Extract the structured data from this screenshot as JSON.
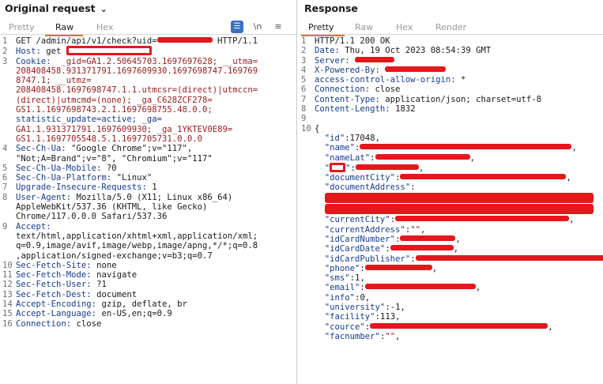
{
  "request": {
    "title": "Original request",
    "tabs": [
      "Pretty",
      "Raw",
      "Hex"
    ],
    "active_tab": "Raw",
    "tools": {
      "newline_toggle": "\\n",
      "menu": "≡"
    },
    "lines": [
      {
        "n": "1",
        "parts": [
          [
            "k",
            "GET /admin/api/v1/check?uid="
          ],
          [
            "redact",
            "70"
          ],
          [
            "k",
            " HTTP/1.1"
          ]
        ]
      },
      {
        "n": "2",
        "parts": [
          [
            "hdr",
            "Host: "
          ],
          [
            "hv",
            "get "
          ],
          [
            "redactbox",
            "108"
          ]
        ]
      },
      {
        "n": "3",
        "parts": [
          [
            "hdr",
            "Cookie: "
          ],
          [
            "ck",
            " _gid=GA1.2.50645703.1697697628; __utma="
          ]
        ]
      },
      {
        "n": "",
        "parts": [
          [
            "ck",
            "208408458.931371791.1697609930.1697698747.169769"
          ]
        ]
      },
      {
        "n": "",
        "parts": [
          [
            "ck",
            "8747.1; __utmz="
          ]
        ]
      },
      {
        "n": "",
        "parts": [
          [
            "ck",
            "208408458.1697698747.1.1.utmcsr=(direct)|utmccn="
          ]
        ]
      },
      {
        "n": "",
        "parts": [
          [
            "ck",
            "(direct)|utmcmd=(none); _ga_C628ZCF278="
          ]
        ]
      },
      {
        "n": "",
        "parts": [
          [
            "ck",
            "GS1.1.1697698743.2.1.1697698755.48.0.0;"
          ]
        ]
      },
      {
        "n": "",
        "parts": [
          [
            "hdr",
            "statistic_update=active; _ga="
          ]
        ]
      },
      {
        "n": "",
        "parts": [
          [
            "ck",
            "GA1.1.931371791.1697609930; _ga_1YKTEV0E89="
          ]
        ]
      },
      {
        "n": "",
        "parts": [
          [
            "ck",
            "GS1.1.1697705548.5.1.1697705731.0.0.0"
          ]
        ]
      },
      {
        "n": "4",
        "parts": [
          [
            "hdr",
            "Sec-Ch-Ua: "
          ],
          [
            "hv",
            "\"Google Chrome\";v=\"117\","
          ]
        ]
      },
      {
        "n": "",
        "parts": [
          [
            "hv",
            "\"Not;A=Brand\";v=\"8\", \"Chromium\";v=\"117\""
          ]
        ]
      },
      {
        "n": "5",
        "parts": [
          [
            "hdr",
            "Sec-Ch-Ua-Mobile: "
          ],
          [
            "hv",
            "?0"
          ]
        ]
      },
      {
        "n": "6",
        "parts": [
          [
            "hdr",
            "Sec-Ch-Ua-Platform: "
          ],
          [
            "hv",
            "\"Linux\""
          ]
        ]
      },
      {
        "n": "7",
        "parts": [
          [
            "hdr",
            "Upgrade-Insecure-Requests: "
          ],
          [
            "hv",
            "1"
          ]
        ]
      },
      {
        "n": "8",
        "parts": [
          [
            "hdr",
            "User-Agent: "
          ],
          [
            "hv",
            "Mozilla/5.0 (X11; Linux x86_64)"
          ]
        ]
      },
      {
        "n": "",
        "parts": [
          [
            "hv",
            "AppleWebKit/537.36 (KHTML, like Gecko)"
          ]
        ]
      },
      {
        "n": "",
        "parts": [
          [
            "hv",
            "Chrome/117.0.0.0 Safari/537.36"
          ]
        ]
      },
      {
        "n": "9",
        "parts": [
          [
            "hdr",
            "Accept: "
          ]
        ]
      },
      {
        "n": "",
        "parts": [
          [
            "hv",
            "text/html,application/xhtml+xml,application/xml;"
          ]
        ]
      },
      {
        "n": "",
        "parts": [
          [
            "hv",
            "q=0.9,image/avif,image/webp,image/apng,*/*;q=0.8"
          ]
        ]
      },
      {
        "n": "",
        "parts": [
          [
            "hv",
            ",application/signed-exchange;v=b3;q=0.7"
          ]
        ]
      },
      {
        "n": "10",
        "parts": [
          [
            "hdr",
            "Sec-Fetch-Site: "
          ],
          [
            "hv",
            "none"
          ]
        ]
      },
      {
        "n": "11",
        "parts": [
          [
            "hdr",
            "Sec-Fetch-Mode: "
          ],
          [
            "hv",
            "navigate"
          ]
        ]
      },
      {
        "n": "12",
        "parts": [
          [
            "hdr",
            "Sec-Fetch-User: "
          ],
          [
            "hv",
            "?1"
          ]
        ]
      },
      {
        "n": "13",
        "parts": [
          [
            "hdr",
            "Sec-Fetch-Dest: "
          ],
          [
            "hv",
            "document"
          ]
        ]
      },
      {
        "n": "14",
        "parts": [
          [
            "hdr",
            "Accept-Encoding: "
          ],
          [
            "hv",
            "gzip, deflate, br"
          ]
        ]
      },
      {
        "n": "15",
        "parts": [
          [
            "hdr",
            "Accept-Language: "
          ],
          [
            "hv",
            "en-US,en;q=0.9"
          ]
        ]
      },
      {
        "n": "16",
        "parts": [
          [
            "hdr",
            "Connection: "
          ],
          [
            "hv",
            "close"
          ]
        ]
      }
    ]
  },
  "response": {
    "title": "Response",
    "tabs": [
      "Pretty",
      "Raw",
      "Hex",
      "Render"
    ],
    "active_tab": "Pretty",
    "lines": [
      {
        "n": "1",
        "parts": [
          [
            "k",
            "HTTP/1.1 200 OK"
          ]
        ]
      },
      {
        "n": "2",
        "parts": [
          [
            "hdr",
            "Date: "
          ],
          [
            "hv",
            "Thu, 19 Oct 2023 08:54:39 GMT"
          ]
        ]
      },
      {
        "n": "3",
        "parts": [
          [
            "hdr",
            "Server: "
          ],
          [
            "redact",
            "50"
          ]
        ]
      },
      {
        "n": "4",
        "parts": [
          [
            "hdr",
            "X-Powered-By: "
          ],
          [
            "redact",
            "77"
          ]
        ]
      },
      {
        "n": "5",
        "parts": [
          [
            "hdr",
            "access-control-allow-origin: "
          ],
          [
            "hv",
            "*"
          ]
        ]
      },
      {
        "n": "6",
        "parts": [
          [
            "hdr",
            "Connection: "
          ],
          [
            "hv",
            "close"
          ]
        ]
      },
      {
        "n": "7",
        "parts": [
          [
            "hdr",
            "Content-Type: "
          ],
          [
            "hv",
            "application/json; charset=utf-8"
          ]
        ]
      },
      {
        "n": "8",
        "parts": [
          [
            "hdr",
            "Content-Length: "
          ],
          [
            "hv",
            "1832"
          ]
        ]
      },
      {
        "n": "9",
        "parts": []
      },
      {
        "n": "10",
        "parts": [
          [
            "pun",
            "{"
          ]
        ]
      },
      {
        "n": "",
        "parts": [
          [
            "pun",
            "  "
          ],
          [
            "jk",
            "\"id\""
          ],
          [
            "pun",
            ":"
          ],
          [
            "jn",
            "17048"
          ],
          [
            "pun",
            ","
          ]
        ]
      },
      {
        "n": "",
        "parts": [
          [
            "pun",
            "  "
          ],
          [
            "jk",
            "\"name\""
          ],
          [
            "pun",
            ":"
          ],
          [
            "redact",
            "268"
          ],
          [
            "pun",
            ","
          ]
        ]
      },
      {
        "n": "",
        "parts": [
          [
            "pun",
            "  "
          ],
          [
            "jk",
            "\"nameLat\""
          ],
          [
            "pun",
            ":"
          ],
          [
            "redact",
            "120"
          ],
          [
            "pun",
            ","
          ]
        ]
      },
      {
        "n": "",
        "parts": [
          [
            "pun",
            "  "
          ],
          [
            "jk",
            "\""
          ],
          [
            "redactbox",
            "20"
          ],
          [
            "jk",
            "\""
          ],
          [
            "pun",
            ":"
          ],
          [
            "redact",
            "80"
          ],
          [
            "pun",
            ","
          ]
        ]
      },
      {
        "n": "",
        "parts": [
          [
            "pun",
            "  "
          ],
          [
            "jk",
            "\"documentCity\""
          ],
          [
            "pun",
            ":"
          ],
          [
            "redact",
            "210"
          ],
          [
            "pun",
            ","
          ]
        ]
      },
      {
        "n": "",
        "parts": [
          [
            "pun",
            "  "
          ],
          [
            "jk",
            "\"documentAddress\""
          ],
          [
            "pun",
            ":"
          ]
        ]
      },
      {
        "n": "",
        "parts": [
          [
            "pun",
            "  "
          ],
          [
            "redactbig",
            "340"
          ]
        ]
      },
      {
        "n": "",
        "parts": [
          [
            "pun",
            "  "
          ],
          [
            "redactbig",
            "340"
          ]
        ]
      },
      {
        "n": "",
        "parts": [
          [
            "pun",
            "  "
          ],
          [
            "jk",
            "\"currentCity\""
          ],
          [
            "pun",
            ":"
          ],
          [
            "redact",
            "220"
          ],
          [
            "pun",
            ","
          ]
        ]
      },
      {
        "n": "",
        "parts": [
          [
            "pun",
            "  "
          ],
          [
            "jk",
            "\"currentAddress\""
          ],
          [
            "pun",
            ":"
          ],
          [
            "js",
            "\"\""
          ],
          [
            "pun",
            ","
          ]
        ]
      },
      {
        "n": "",
        "parts": [
          [
            "pun",
            "  "
          ],
          [
            "jk",
            "\"idCardNumber\""
          ],
          [
            "pun",
            ":"
          ],
          [
            "redact",
            "70"
          ],
          [
            "pun",
            ","
          ]
        ]
      },
      {
        "n": "",
        "parts": [
          [
            "pun",
            "  "
          ],
          [
            "jk",
            "\"idCardDate\""
          ],
          [
            "pun",
            ":"
          ],
          [
            "redact",
            "80"
          ],
          [
            "pun",
            ","
          ]
        ]
      },
      {
        "n": "",
        "parts": [
          [
            "pun",
            "  "
          ],
          [
            "jk",
            "\"idCardPublisher\""
          ],
          [
            "pun",
            ":"
          ],
          [
            "redact",
            "245"
          ],
          [
            "pun",
            ","
          ]
        ]
      },
      {
        "n": "",
        "parts": [
          [
            "pun",
            "  "
          ],
          [
            "jk",
            "\"phone\""
          ],
          [
            "pun",
            ":"
          ],
          [
            "redact",
            "85"
          ],
          [
            "pun",
            ","
          ]
        ]
      },
      {
        "n": "",
        "parts": [
          [
            "pun",
            "  "
          ],
          [
            "jk",
            "\"sms\""
          ],
          [
            "pun",
            ":"
          ],
          [
            "jn",
            "1"
          ],
          [
            "pun",
            ","
          ]
        ]
      },
      {
        "n": "",
        "parts": [
          [
            "pun",
            "  "
          ],
          [
            "jk",
            "\"email\""
          ],
          [
            "pun",
            ":"
          ],
          [
            "redact",
            "140"
          ],
          [
            "pun",
            ","
          ]
        ]
      },
      {
        "n": "",
        "parts": [
          [
            "pun",
            "  "
          ],
          [
            "jk",
            "\"info\""
          ],
          [
            "pun",
            ":"
          ],
          [
            "jn",
            "0"
          ],
          [
            "pun",
            ","
          ]
        ]
      },
      {
        "n": "",
        "parts": [
          [
            "pun",
            "  "
          ],
          [
            "jk",
            "\"university\""
          ],
          [
            "pun",
            ":"
          ],
          [
            "jn",
            "-1"
          ],
          [
            "pun",
            ","
          ]
        ]
      },
      {
        "n": "",
        "parts": [
          [
            "pun",
            "  "
          ],
          [
            "jk",
            "\"facility\""
          ],
          [
            "pun",
            ":"
          ],
          [
            "jn",
            "113"
          ],
          [
            "pun",
            ","
          ]
        ]
      },
      {
        "n": "",
        "parts": [
          [
            "pun",
            "  "
          ],
          [
            "jk",
            "\"cource\""
          ],
          [
            "pun",
            ":"
          ],
          [
            "redact",
            "225"
          ],
          [
            "pun",
            ","
          ]
        ]
      },
      {
        "n": "",
        "parts": [
          [
            "pun",
            "  "
          ],
          [
            "jk",
            "\"facnumber\""
          ],
          [
            "pun",
            ":"
          ],
          [
            "js",
            "\"\""
          ],
          [
            "pun",
            ","
          ]
        ]
      }
    ]
  },
  "colors": {
    "accent_tab": "#e8702a",
    "redaction": "#e5171c",
    "header_name": "#173b8f",
    "cookie_value": "#9b1b1b",
    "wrap_button": "#3a70c4"
  }
}
